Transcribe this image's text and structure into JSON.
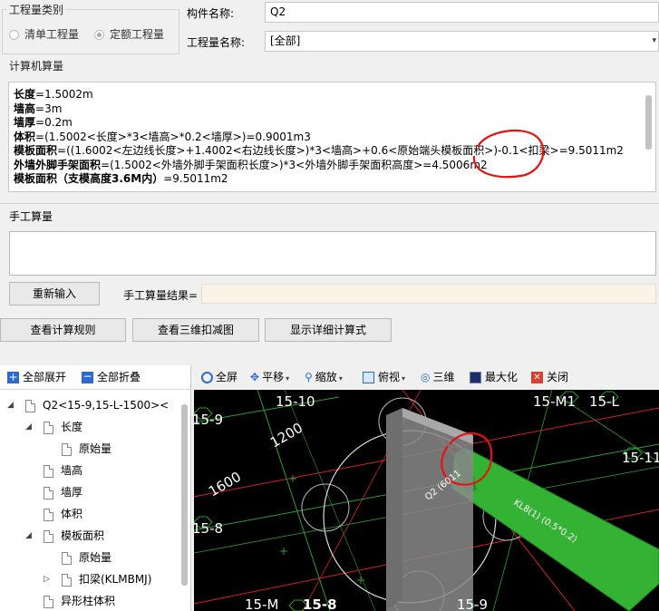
{
  "quantity_type": {
    "legend": "工程量类别",
    "options": [
      {
        "label": "清单工程量",
        "selected": false
      },
      {
        "label": "定额工程量",
        "selected": true
      }
    ]
  },
  "component": {
    "name_label": "构件名称:",
    "name_value": "Q2",
    "qty_label": "工程量名称:",
    "qty_value": "[全部]"
  },
  "computer_calc": {
    "legend": "计算机算量",
    "lines": [
      {
        "name": "长度",
        "expr": "=1.5002m"
      },
      {
        "name": "墙高",
        "expr": "=3m"
      },
      {
        "name": "墙厚",
        "expr": "=0.2m"
      },
      {
        "name": "体积",
        "expr": "=(1.5002<长度>*3<墙高>*0.2<墙厚>)=0.9001m3"
      },
      {
        "name": "模板面积",
        "expr": "=((1.6002<左边线长度>+1.4002<右边线长度>)*3<墙高>+0.6<原始端头模板面积>)-0.1<扣梁>=9.5011m2"
      },
      {
        "name": "外墙外脚手架面积",
        "expr": "=(1.5002<外墙外脚手架面积长度>)*3<外墙外脚手架面积高度>=4.5006m2"
      },
      {
        "name": "模板面积（支模高度3.6M内）",
        "expr": "=9.5011m2"
      }
    ]
  },
  "manual_calc": {
    "legend": "手工算量",
    "reenter_button": "重新输入",
    "result_label": "手工算量结果=",
    "result_value": ""
  },
  "actions": {
    "view_rules": "查看计算规则",
    "view_3d": "查看三维扣减图",
    "show_detail": "显示详细计算式"
  },
  "tree_toolbar": {
    "expand_all": "全部展开",
    "collapse_all": "全部折叠"
  },
  "tree": [
    {
      "label": "Q2<15-9,15-L-1500><",
      "level": 0,
      "toggle": "open"
    },
    {
      "label": "长度",
      "level": 1,
      "toggle": "open"
    },
    {
      "label": "原始量",
      "level": 2,
      "toggle": ""
    },
    {
      "label": "墙高",
      "level": 1,
      "toggle": ""
    },
    {
      "label": "墙厚",
      "level": 1,
      "toggle": ""
    },
    {
      "label": "体积",
      "level": 1,
      "toggle": ""
    },
    {
      "label": "模板面积",
      "level": 1,
      "toggle": "open",
      "selected": true
    },
    {
      "label": "原始量",
      "level": 2,
      "toggle": ""
    },
    {
      "label": "扣梁(KLMBMJ)",
      "level": 2,
      "toggle": "closed"
    },
    {
      "label": "异形柱体积",
      "level": 1,
      "toggle": ""
    }
  ],
  "view_toolbar": {
    "fullscreen": "全屏",
    "pan": "平移",
    "zoom": "缩放",
    "view": "俯视",
    "three_d": "三维",
    "maximize": "最大化",
    "close": "关闭"
  },
  "viewport": {
    "axis_labels": [
      "15-10",
      "15-M",
      "15-M1",
      "15-L",
      "15-9",
      "15-8",
      "15-11",
      "15-M",
      "15-8",
      "15-9"
    ],
    "dim_labels": [
      "1200",
      "1600"
    ],
    "wall_label": "Q2 (6011",
    "beam_label": "KL8(1) (0.5*0.2)"
  },
  "colors": {
    "accent": "#3aa53a",
    "annotation": "#e81010",
    "selected": "#c4daf2"
  }
}
